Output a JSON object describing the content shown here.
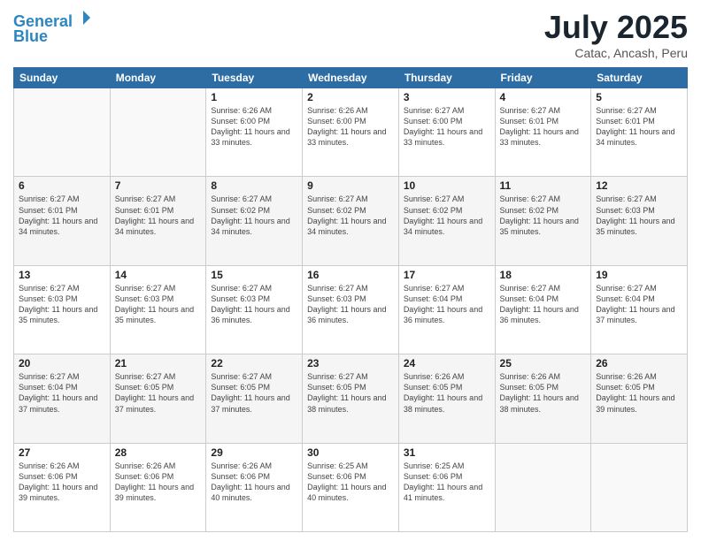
{
  "header": {
    "logo_line1": "General",
    "logo_line2": "Blue",
    "month_title": "July 2025",
    "location": "Catac, Ancash, Peru"
  },
  "days_of_week": [
    "Sunday",
    "Monday",
    "Tuesday",
    "Wednesday",
    "Thursday",
    "Friday",
    "Saturday"
  ],
  "weeks": [
    [
      {
        "day": "",
        "sunrise": "",
        "sunset": "",
        "daylight": ""
      },
      {
        "day": "",
        "sunrise": "",
        "sunset": "",
        "daylight": ""
      },
      {
        "day": "1",
        "sunrise": "Sunrise: 6:26 AM",
        "sunset": "Sunset: 6:00 PM",
        "daylight": "Daylight: 11 hours and 33 minutes."
      },
      {
        "day": "2",
        "sunrise": "Sunrise: 6:26 AM",
        "sunset": "Sunset: 6:00 PM",
        "daylight": "Daylight: 11 hours and 33 minutes."
      },
      {
        "day": "3",
        "sunrise": "Sunrise: 6:27 AM",
        "sunset": "Sunset: 6:00 PM",
        "daylight": "Daylight: 11 hours and 33 minutes."
      },
      {
        "day": "4",
        "sunrise": "Sunrise: 6:27 AM",
        "sunset": "Sunset: 6:01 PM",
        "daylight": "Daylight: 11 hours and 33 minutes."
      },
      {
        "day": "5",
        "sunrise": "Sunrise: 6:27 AM",
        "sunset": "Sunset: 6:01 PM",
        "daylight": "Daylight: 11 hours and 34 minutes."
      }
    ],
    [
      {
        "day": "6",
        "sunrise": "Sunrise: 6:27 AM",
        "sunset": "Sunset: 6:01 PM",
        "daylight": "Daylight: 11 hours and 34 minutes."
      },
      {
        "day": "7",
        "sunrise": "Sunrise: 6:27 AM",
        "sunset": "Sunset: 6:01 PM",
        "daylight": "Daylight: 11 hours and 34 minutes."
      },
      {
        "day": "8",
        "sunrise": "Sunrise: 6:27 AM",
        "sunset": "Sunset: 6:02 PM",
        "daylight": "Daylight: 11 hours and 34 minutes."
      },
      {
        "day": "9",
        "sunrise": "Sunrise: 6:27 AM",
        "sunset": "Sunset: 6:02 PM",
        "daylight": "Daylight: 11 hours and 34 minutes."
      },
      {
        "day": "10",
        "sunrise": "Sunrise: 6:27 AM",
        "sunset": "Sunset: 6:02 PM",
        "daylight": "Daylight: 11 hours and 34 minutes."
      },
      {
        "day": "11",
        "sunrise": "Sunrise: 6:27 AM",
        "sunset": "Sunset: 6:02 PM",
        "daylight": "Daylight: 11 hours and 35 minutes."
      },
      {
        "day": "12",
        "sunrise": "Sunrise: 6:27 AM",
        "sunset": "Sunset: 6:03 PM",
        "daylight": "Daylight: 11 hours and 35 minutes."
      }
    ],
    [
      {
        "day": "13",
        "sunrise": "Sunrise: 6:27 AM",
        "sunset": "Sunset: 6:03 PM",
        "daylight": "Daylight: 11 hours and 35 minutes."
      },
      {
        "day": "14",
        "sunrise": "Sunrise: 6:27 AM",
        "sunset": "Sunset: 6:03 PM",
        "daylight": "Daylight: 11 hours and 35 minutes."
      },
      {
        "day": "15",
        "sunrise": "Sunrise: 6:27 AM",
        "sunset": "Sunset: 6:03 PM",
        "daylight": "Daylight: 11 hours and 36 minutes."
      },
      {
        "day": "16",
        "sunrise": "Sunrise: 6:27 AM",
        "sunset": "Sunset: 6:03 PM",
        "daylight": "Daylight: 11 hours and 36 minutes."
      },
      {
        "day": "17",
        "sunrise": "Sunrise: 6:27 AM",
        "sunset": "Sunset: 6:04 PM",
        "daylight": "Daylight: 11 hours and 36 minutes."
      },
      {
        "day": "18",
        "sunrise": "Sunrise: 6:27 AM",
        "sunset": "Sunset: 6:04 PM",
        "daylight": "Daylight: 11 hours and 36 minutes."
      },
      {
        "day": "19",
        "sunrise": "Sunrise: 6:27 AM",
        "sunset": "Sunset: 6:04 PM",
        "daylight": "Daylight: 11 hours and 37 minutes."
      }
    ],
    [
      {
        "day": "20",
        "sunrise": "Sunrise: 6:27 AM",
        "sunset": "Sunset: 6:04 PM",
        "daylight": "Daylight: 11 hours and 37 minutes."
      },
      {
        "day": "21",
        "sunrise": "Sunrise: 6:27 AM",
        "sunset": "Sunset: 6:05 PM",
        "daylight": "Daylight: 11 hours and 37 minutes."
      },
      {
        "day": "22",
        "sunrise": "Sunrise: 6:27 AM",
        "sunset": "Sunset: 6:05 PM",
        "daylight": "Daylight: 11 hours and 37 minutes."
      },
      {
        "day": "23",
        "sunrise": "Sunrise: 6:27 AM",
        "sunset": "Sunset: 6:05 PM",
        "daylight": "Daylight: 11 hours and 38 minutes."
      },
      {
        "day": "24",
        "sunrise": "Sunrise: 6:26 AM",
        "sunset": "Sunset: 6:05 PM",
        "daylight": "Daylight: 11 hours and 38 minutes."
      },
      {
        "day": "25",
        "sunrise": "Sunrise: 6:26 AM",
        "sunset": "Sunset: 6:05 PM",
        "daylight": "Daylight: 11 hours and 38 minutes."
      },
      {
        "day": "26",
        "sunrise": "Sunrise: 6:26 AM",
        "sunset": "Sunset: 6:05 PM",
        "daylight": "Daylight: 11 hours and 39 minutes."
      }
    ],
    [
      {
        "day": "27",
        "sunrise": "Sunrise: 6:26 AM",
        "sunset": "Sunset: 6:06 PM",
        "daylight": "Daylight: 11 hours and 39 minutes."
      },
      {
        "day": "28",
        "sunrise": "Sunrise: 6:26 AM",
        "sunset": "Sunset: 6:06 PM",
        "daylight": "Daylight: 11 hours and 39 minutes."
      },
      {
        "day": "29",
        "sunrise": "Sunrise: 6:26 AM",
        "sunset": "Sunset: 6:06 PM",
        "daylight": "Daylight: 11 hours and 40 minutes."
      },
      {
        "day": "30",
        "sunrise": "Sunrise: 6:25 AM",
        "sunset": "Sunset: 6:06 PM",
        "daylight": "Daylight: 11 hours and 40 minutes."
      },
      {
        "day": "31",
        "sunrise": "Sunrise: 6:25 AM",
        "sunset": "Sunset: 6:06 PM",
        "daylight": "Daylight: 11 hours and 41 minutes."
      },
      {
        "day": "",
        "sunrise": "",
        "sunset": "",
        "daylight": ""
      },
      {
        "day": "",
        "sunrise": "",
        "sunset": "",
        "daylight": ""
      }
    ]
  ]
}
